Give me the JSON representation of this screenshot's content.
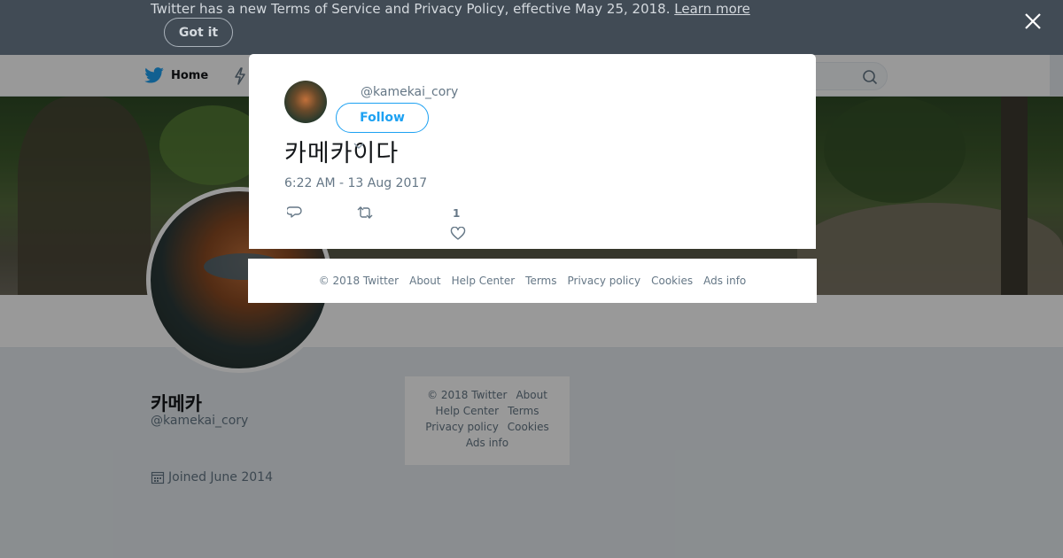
{
  "notice": {
    "text": "Twitter has a new Terms of Service and Privacy Policy, effective May 25, 2018.",
    "link": "Learn more",
    "button": "Got it"
  },
  "nav": {
    "home": "Home"
  },
  "profile": {
    "name": "카메카",
    "handle": "@kamekai_cory",
    "joined": "Joined June 2014"
  },
  "side_footer": {
    "items": [
      "© 2018 Twitter",
      "About",
      "Help Center",
      "Terms",
      "Privacy policy",
      "Cookies",
      "Ads info"
    ]
  },
  "tweet": {
    "handle": "@kamekai_cory",
    "follow": "Follow",
    "text": "카메카이다",
    "time": "6:22 AM - 13 Aug 2017",
    "likes": "1"
  },
  "modal_footer": {
    "copyright": "© 2018 Twitter",
    "about": "About",
    "help": "Help Center",
    "terms": "Terms",
    "privacy": "Privacy policy",
    "cookies": "Cookies",
    "ads": "Ads info"
  },
  "colors": {
    "accent": "#1da1f2",
    "notice_bg": "#414b55",
    "muted": "#657786"
  }
}
